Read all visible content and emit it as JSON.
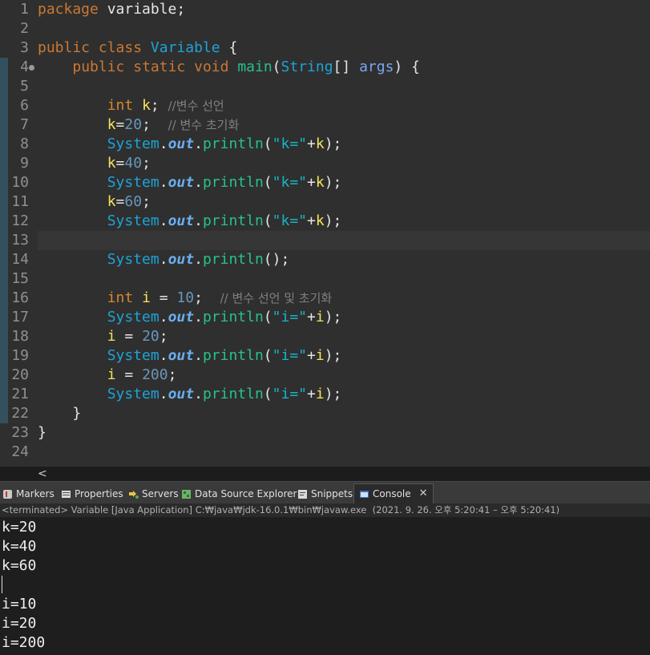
{
  "editor": {
    "lines": [
      {
        "n": "1",
        "tokens": [
          [
            "kw",
            "package"
          ],
          [
            "pl",
            " variable;"
          ]
        ]
      },
      {
        "n": "2",
        "tokens": []
      },
      {
        "n": "3",
        "tokens": [
          [
            "kw",
            "public"
          ],
          [
            "pl",
            " "
          ],
          [
            "kw",
            "class"
          ],
          [
            "pl",
            " "
          ],
          [
            "type",
            "Variable"
          ],
          [
            "pl",
            " {"
          ]
        ]
      },
      {
        "n": "4",
        "marker": true,
        "tokens": [
          [
            "pl",
            "    "
          ],
          [
            "kw",
            "public"
          ],
          [
            "pl",
            " "
          ],
          [
            "kw",
            "static"
          ],
          [
            "pl",
            " "
          ],
          [
            "kw",
            "void"
          ],
          [
            "pl",
            " "
          ],
          [
            "method",
            "main"
          ],
          [
            "pl",
            "("
          ],
          [
            "type",
            "String"
          ],
          [
            "pl",
            "[] "
          ],
          [
            "param",
            "args"
          ],
          [
            "pl",
            ") {"
          ]
        ]
      },
      {
        "n": "5",
        "tokens": []
      },
      {
        "n": "6",
        "tokens": [
          [
            "pl",
            "        "
          ],
          [
            "kw2",
            "int"
          ],
          [
            "pl",
            " "
          ],
          [
            "var",
            "k"
          ],
          [
            "pl",
            "; "
          ],
          [
            "comment",
            "//변수 선언"
          ]
        ]
      },
      {
        "n": "7",
        "tokens": [
          [
            "pl",
            "        "
          ],
          [
            "var",
            "k"
          ],
          [
            "pl",
            "="
          ],
          [
            "num",
            "20"
          ],
          [
            "pl",
            ";  "
          ],
          [
            "comment",
            "// 변수 초기화"
          ]
        ]
      },
      {
        "n": "8",
        "tokens": [
          [
            "pl",
            "        "
          ],
          [
            "type",
            "System"
          ],
          [
            "pl",
            "."
          ],
          [
            "field",
            "out"
          ],
          [
            "pl",
            "."
          ],
          [
            "method",
            "println"
          ],
          [
            "pl",
            "("
          ],
          [
            "str",
            "\"k=\""
          ],
          [
            "pl",
            "+"
          ],
          [
            "var",
            "k"
          ],
          [
            "pl",
            ");"
          ]
        ]
      },
      {
        "n": "9",
        "tokens": [
          [
            "pl",
            "        "
          ],
          [
            "var",
            "k"
          ],
          [
            "pl",
            "="
          ],
          [
            "num",
            "40"
          ],
          [
            "pl",
            ";"
          ]
        ]
      },
      {
        "n": "10",
        "tokens": [
          [
            "pl",
            "        "
          ],
          [
            "type",
            "System"
          ],
          [
            "pl",
            "."
          ],
          [
            "field",
            "out"
          ],
          [
            "pl",
            "."
          ],
          [
            "method",
            "println"
          ],
          [
            "pl",
            "("
          ],
          [
            "str",
            "\"k=\""
          ],
          [
            "pl",
            "+"
          ],
          [
            "var",
            "k"
          ],
          [
            "pl",
            ");"
          ]
        ]
      },
      {
        "n": "11",
        "tokens": [
          [
            "pl",
            "        "
          ],
          [
            "var",
            "k"
          ],
          [
            "pl",
            "="
          ],
          [
            "num",
            "60"
          ],
          [
            "pl",
            ";"
          ]
        ]
      },
      {
        "n": "12",
        "tokens": [
          [
            "pl",
            "        "
          ],
          [
            "type",
            "System"
          ],
          [
            "pl",
            "."
          ],
          [
            "field",
            "out"
          ],
          [
            "pl",
            "."
          ],
          [
            "method",
            "println"
          ],
          [
            "pl",
            "("
          ],
          [
            "str",
            "\"k=\""
          ],
          [
            "pl",
            "+"
          ],
          [
            "var",
            "k"
          ],
          [
            "pl",
            ");"
          ]
        ]
      },
      {
        "n": "13",
        "current": true,
        "tokens": []
      },
      {
        "n": "14",
        "tokens": [
          [
            "pl",
            "        "
          ],
          [
            "type",
            "System"
          ],
          [
            "pl",
            "."
          ],
          [
            "field",
            "out"
          ],
          [
            "pl",
            "."
          ],
          [
            "method",
            "println"
          ],
          [
            "pl",
            "();"
          ]
        ]
      },
      {
        "n": "15",
        "tokens": []
      },
      {
        "n": "16",
        "tokens": [
          [
            "pl",
            "        "
          ],
          [
            "kw2",
            "int"
          ],
          [
            "pl",
            " "
          ],
          [
            "var",
            "i"
          ],
          [
            "pl",
            " = "
          ],
          [
            "num",
            "10"
          ],
          [
            "pl",
            ";  "
          ],
          [
            "comment",
            "// 변수 선언 및 초기화"
          ]
        ]
      },
      {
        "n": "17",
        "tokens": [
          [
            "pl",
            "        "
          ],
          [
            "type",
            "System"
          ],
          [
            "pl",
            "."
          ],
          [
            "field",
            "out"
          ],
          [
            "pl",
            "."
          ],
          [
            "method",
            "println"
          ],
          [
            "pl",
            "("
          ],
          [
            "str",
            "\"i=\""
          ],
          [
            "pl",
            "+"
          ],
          [
            "var",
            "i"
          ],
          [
            "pl",
            ");"
          ]
        ]
      },
      {
        "n": "18",
        "tokens": [
          [
            "pl",
            "        "
          ],
          [
            "var",
            "i"
          ],
          [
            "pl",
            " = "
          ],
          [
            "num",
            "20"
          ],
          [
            "pl",
            ";"
          ]
        ]
      },
      {
        "n": "19",
        "tokens": [
          [
            "pl",
            "        "
          ],
          [
            "type",
            "System"
          ],
          [
            "pl",
            "."
          ],
          [
            "field",
            "out"
          ],
          [
            "pl",
            "."
          ],
          [
            "method",
            "println"
          ],
          [
            "pl",
            "("
          ],
          [
            "str",
            "\"i=\""
          ],
          [
            "pl",
            "+"
          ],
          [
            "var",
            "i"
          ],
          [
            "pl",
            ");"
          ]
        ]
      },
      {
        "n": "20",
        "tokens": [
          [
            "pl",
            "        "
          ],
          [
            "var",
            "i"
          ],
          [
            "pl",
            " = "
          ],
          [
            "num",
            "200"
          ],
          [
            "pl",
            ";"
          ]
        ]
      },
      {
        "n": "21",
        "tokens": [
          [
            "pl",
            "        "
          ],
          [
            "type",
            "System"
          ],
          [
            "pl",
            "."
          ],
          [
            "field",
            "out"
          ],
          [
            "pl",
            "."
          ],
          [
            "method",
            "println"
          ],
          [
            "pl",
            "("
          ],
          [
            "str",
            "\"i=\""
          ],
          [
            "pl",
            "+"
          ],
          [
            "var",
            "i"
          ],
          [
            "pl",
            ");"
          ]
        ]
      },
      {
        "n": "22",
        "tokens": [
          [
            "pl",
            "    }"
          ]
        ]
      },
      {
        "n": "23",
        "tokens": [
          [
            "pl",
            "}"
          ]
        ]
      },
      {
        "n": "24",
        "tokens": []
      }
    ]
  },
  "scroll": {
    "left_arrow": "<"
  },
  "tabs": [
    {
      "label": "Markers",
      "icon": "markers-icon"
    },
    {
      "label": "Properties",
      "icon": "properties-icon"
    },
    {
      "label": "Servers",
      "icon": "servers-icon"
    },
    {
      "label": "Data Source Explorer",
      "icon": "data-source-explorer-icon"
    },
    {
      "label": "Snippets",
      "icon": "snippets-icon"
    },
    {
      "label": "Console",
      "icon": "console-icon",
      "active": true,
      "close": "✕"
    }
  ],
  "console": {
    "status": "<terminated> Variable [Java Application] C:₩java₩jdk-16.0.1₩bin₩javaw.exe  (2021. 9. 26. 오후 5:20:41 – 오후 5:20:41)",
    "output": [
      "k=20",
      "k=40",
      "k=60",
      "",
      "i=10",
      "i=20",
      "i=200"
    ]
  },
  "colors": {
    "editor_bg": "#2f2f2f",
    "keyword": "#cc7832",
    "type": "#1ea3d6",
    "method": "#27c08d",
    "variable": "#f5e35b",
    "string": "#17b5c5",
    "number": "#6897bb",
    "comment": "#808080"
  }
}
